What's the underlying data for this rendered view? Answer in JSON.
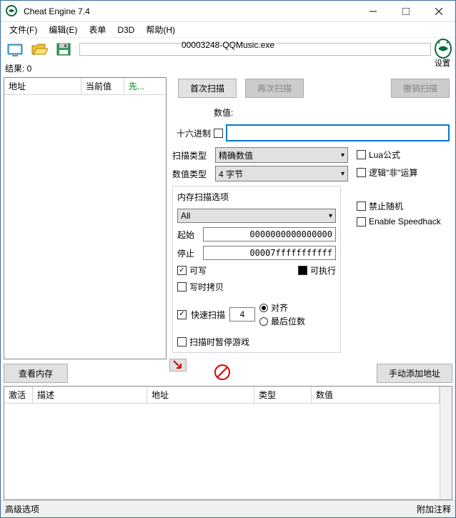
{
  "window": {
    "title": "Cheat Engine 7.4"
  },
  "menu": {
    "file": "文件(F)",
    "edit": "编辑(E)",
    "table": "表单",
    "d3d": "D3D",
    "help": "帮助(H)"
  },
  "process_name": "00003248-QQMusic.exe",
  "settings_label": "设置",
  "results_label": "结果: 0",
  "left_columns": {
    "address": "地址",
    "current": "当前值",
    "prev": "先..."
  },
  "scan_buttons": {
    "first": "首次扫描",
    "next": "再次扫描",
    "undo": "撤销扫描"
  },
  "value": {
    "label": "数值:",
    "hex_label": "十六进制",
    "input": ""
  },
  "scan_type": {
    "label": "扫描类型",
    "value": "精确数值"
  },
  "value_type": {
    "label": "数值类型",
    "value": "4 字节"
  },
  "side_checks": {
    "lua": "Lua公式",
    "not": "逻辑\"非\"运算",
    "random": "禁止随机",
    "speedhack": "Enable Speedhack"
  },
  "mem_options": {
    "title": "内存扫描选项",
    "all": "All",
    "start_label": "起始",
    "start_value": "0000000000000000",
    "stop_label": "停止",
    "stop_value": "00007fffffffffff",
    "writable": "可写",
    "executable": "可执行",
    "copy_on_write": "写时拷贝",
    "fast_scan": "快速扫描",
    "fast_value": "4",
    "align": "对齐",
    "last_digits": "最后位数",
    "pause": "扫描时暂停游戏"
  },
  "mid_buttons": {
    "view_memory": "查看内存",
    "add_manual": "手动添加地址"
  },
  "table_columns": {
    "active": "激活",
    "desc": "描述",
    "address": "地址",
    "type": "类型",
    "value": "数值"
  },
  "statusbar": {
    "advanced": "高级选项",
    "comment": "附加注释"
  }
}
